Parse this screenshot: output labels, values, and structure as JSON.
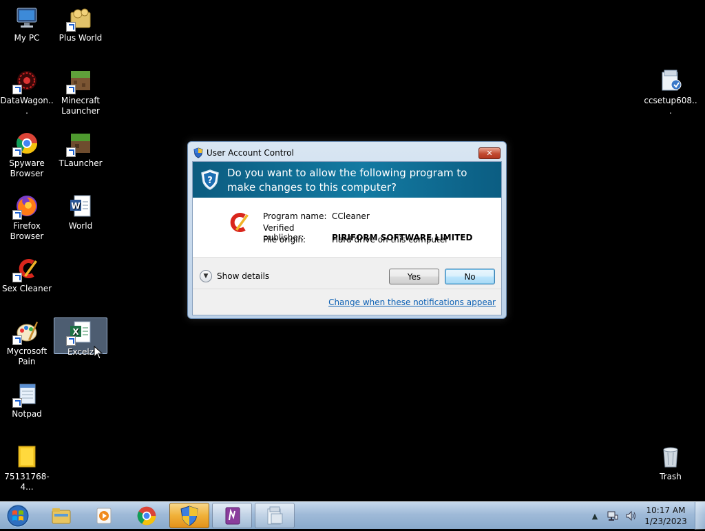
{
  "desktop": {
    "icons": [
      {
        "label": "My PC"
      },
      {
        "label": "Plus World"
      },
      {
        "label": "DataWagon..."
      },
      {
        "label": "Minecraft Launcher"
      },
      {
        "label": "Spyware Browser"
      },
      {
        "label": "TLauncher"
      },
      {
        "label": "Firefox Browser"
      },
      {
        "label": "World"
      },
      {
        "label": "Sex Cleaner"
      },
      {
        "label": "Mycrosoft Pain"
      },
      {
        "label": "Excelz"
      },
      {
        "label": "Notpad"
      },
      {
        "label": "75131768-4..."
      },
      {
        "label": "ccsetup608..."
      },
      {
        "label": "Trash"
      }
    ]
  },
  "uac": {
    "title": "User Account Control",
    "close_glyph": "✕",
    "question": "Do you want to allow the following program to make changes to this computer?",
    "program_name_key": "Program name:",
    "program_name_value": "CCleaner",
    "publisher_key": "Verified publisher:",
    "publisher_value": "PIRIFORM SOFTWARE LIMITED",
    "origin_key": "File origin:",
    "origin_value": "Hard drive on this computer",
    "show_details": "Show details",
    "yes_label": "Yes",
    "no_label": "No",
    "change_link": "Change when these notifications appear"
  },
  "taskbar": {
    "time": "10:17 AM",
    "date": "1/23/2023",
    "tray_up_glyph": "▲"
  },
  "colors": {
    "banner": "#137aa2",
    "taskbar": "#9fbad8",
    "link": "#0a5fb4"
  }
}
